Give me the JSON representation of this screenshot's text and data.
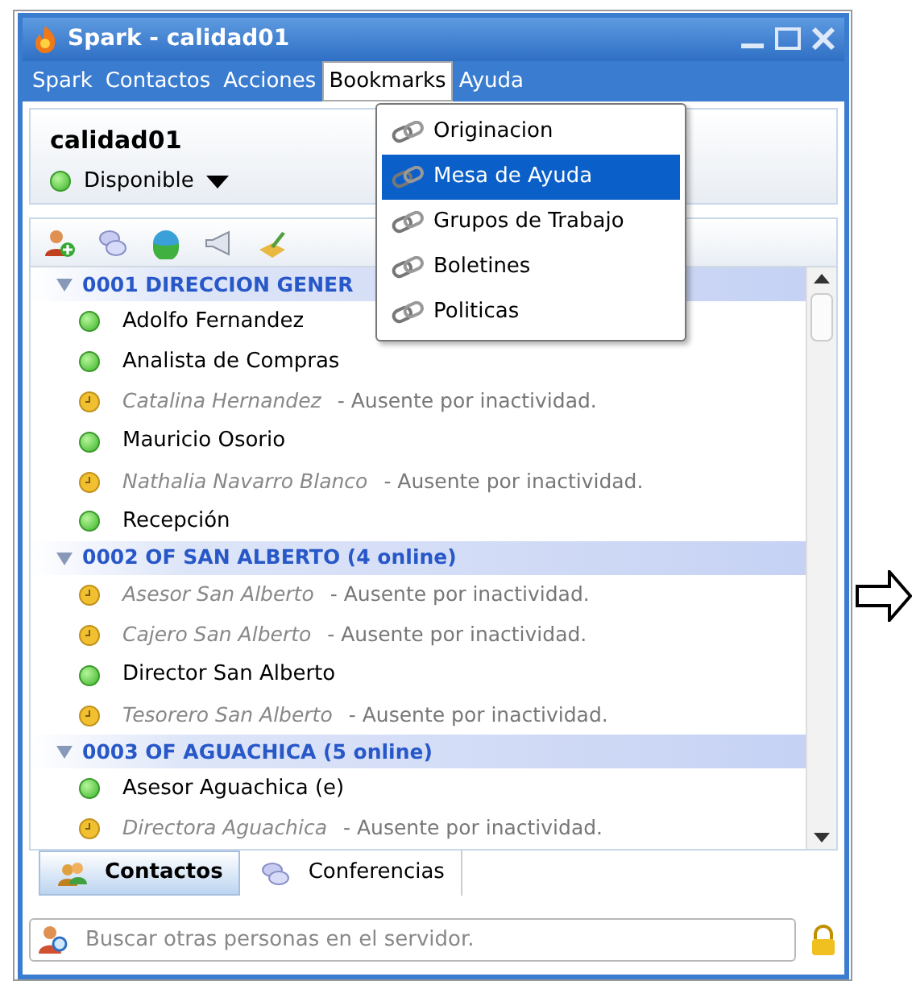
{
  "window": {
    "title": "Spark - calidad01"
  },
  "menu_bar": [
    {
      "label": "Spark",
      "selected": false
    },
    {
      "label": "Contactos",
      "selected": false
    },
    {
      "label": "Acciones",
      "selected": false
    },
    {
      "label": "Bookmarks",
      "selected": true
    },
    {
      "label": "Ayuda",
      "selected": false
    }
  ],
  "bookmarks_menu": [
    {
      "label": "Originacion",
      "selected": false
    },
    {
      "label": "Mesa de Ayuda",
      "selected": true
    },
    {
      "label": "Grupos de Trabajo",
      "selected": false
    },
    {
      "label": "Boletines",
      "selected": false
    },
    {
      "label": "Politicas",
      "selected": false
    }
  ],
  "profile": {
    "name": "calidad01",
    "status": "Disponible"
  },
  "groups": [
    {
      "title": "0001 DIRECCION GENER",
      "expanded": true,
      "contacts": [
        {
          "name": "Adolfo Fernandez",
          "kind": "available"
        },
        {
          "name": "Analista de Compras",
          "kind": "available"
        },
        {
          "name": "Catalina Hernandez",
          "kind": "away",
          "status": "- Ausente por inactividad."
        },
        {
          "name": "Mauricio Osorio",
          "kind": "available"
        },
        {
          "name": "Nathalia Navarro Blanco",
          "kind": "away",
          "status": "- Ausente por inactividad."
        },
        {
          "name": "Recepción",
          "kind": "available"
        }
      ]
    },
    {
      "title": "0002 OF SAN ALBERTO (4 online)",
      "expanded": true,
      "contacts": [
        {
          "name": "Asesor San Alberto",
          "kind": "away",
          "status": "- Ausente por inactividad."
        },
        {
          "name": "Cajero San Alberto",
          "kind": "away",
          "status": "- Ausente por inactividad."
        },
        {
          "name": "Director San Alberto",
          "kind": "available"
        },
        {
          "name": "Tesorero San Alberto",
          "kind": "away",
          "status": "- Ausente por inactividad."
        }
      ]
    },
    {
      "title": "0003 OF AGUACHICA (5 online)",
      "expanded": true,
      "contacts": [
        {
          "name": "Asesor Aguachica (e)",
          "kind": "available"
        },
        {
          "name": "Directora Aguachica",
          "kind": "away",
          "status": "- Ausente por inactividad."
        }
      ]
    }
  ],
  "tabs": [
    {
      "label": "Contactos",
      "selected": true
    },
    {
      "label": "Conferencias",
      "selected": false
    }
  ],
  "search": {
    "placeholder": "Buscar otras personas en el servidor."
  }
}
